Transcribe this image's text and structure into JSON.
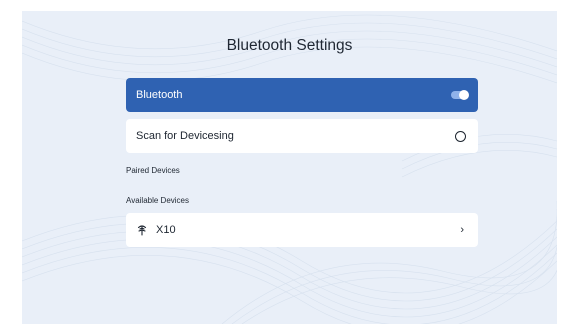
{
  "page": {
    "title": "Bluetooth Settings"
  },
  "bluetooth": {
    "label": "Bluetooth",
    "enabled": true,
    "accent_color": "#2f62b2"
  },
  "scan": {
    "label": "Scan for Devicesing",
    "icon": "loading-ring-icon"
  },
  "sections": {
    "paired_label": "Paired Devices",
    "available_label": "Available Devices"
  },
  "available_devices": [
    {
      "name": "X10",
      "icon": "device-icon",
      "chevron": "›"
    }
  ]
}
